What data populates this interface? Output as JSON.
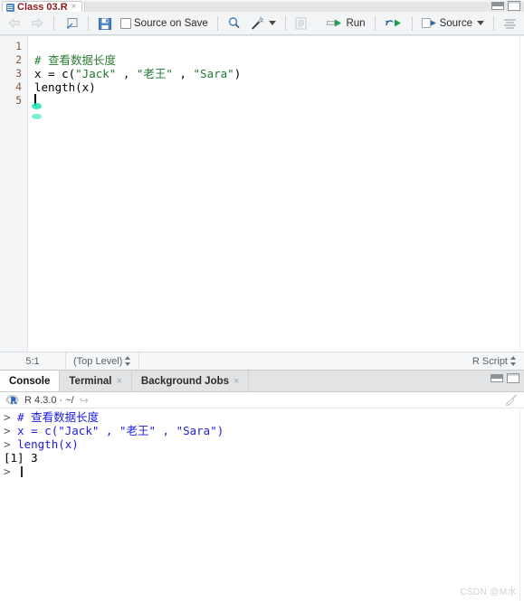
{
  "source_pane": {
    "tab": {
      "icon": "r-document-icon",
      "name": "Class 03.R",
      "close": "×"
    },
    "window_controls": {
      "minimize": "minimize-icon",
      "maximize": "maximize-icon"
    },
    "toolbar": {
      "back": "back-arrow-icon",
      "forward": "forward-arrow-icon",
      "popout": "show-in-new-window-icon",
      "save": "save-icon",
      "source_on_save_checkbox": "checkbox",
      "source_on_save_label": "Source on Save",
      "find": "find-replace-icon",
      "wand": "code-tools-icon",
      "wand_caret": "chevron-down-icon",
      "outline": "document-outline-icon",
      "run_label": "Run",
      "rerun": "rerun-previous-icon",
      "source_label": "Source",
      "source_caret": "chevron-down-icon",
      "show_outline": "show-document-outline-icon"
    },
    "editor": {
      "line_numbers": [
        "1",
        "2",
        "3",
        "4",
        "5"
      ],
      "lines": [
        {
          "num": "1",
          "tokens": []
        },
        {
          "num": "2",
          "tokens": [
            {
              "t": "# 查看数据长度",
              "c": "comment"
            }
          ]
        },
        {
          "num": "3",
          "tokens": [
            {
              "t": "x = c(",
              "c": "plain"
            },
            {
              "t": "\"Jack\"",
              "c": "str"
            },
            {
              "t": " , ",
              "c": "plain"
            },
            {
              "t": "\"老王\"",
              "c": "str"
            },
            {
              "t": " , ",
              "c": "plain"
            },
            {
              "t": "\"Sara\"",
              "c": "str"
            },
            {
              "t": ")",
              "c": "plain"
            }
          ]
        },
        {
          "num": "4",
          "tokens": [
            {
              "t": "length(x)",
              "c": "plain"
            }
          ]
        },
        {
          "num": "5",
          "tokens": []
        }
      ],
      "line1_text": "",
      "line2_text": "# 查看数据长度",
      "line3_a": "x = c(",
      "line3_s1": "\"Jack\"",
      "line3_b": " , ",
      "line3_s2": "\"老王\"",
      "line3_c": " , ",
      "line3_s3": "\"Sara\"",
      "line3_d": ")",
      "line4_text": "length(x)",
      "line5_text": ""
    },
    "status_bar": {
      "cursor_position": "5:1",
      "scope": "(Top Level)",
      "scope_stepper": "up-down-arrows-icon",
      "file_type": "R Script",
      "file_type_stepper": "up-down-arrows-icon"
    }
  },
  "console_pane": {
    "tabs": [
      {
        "label": "Console",
        "active": true,
        "closable": false
      },
      {
        "label": "Terminal",
        "active": false,
        "closable": true,
        "close": "×"
      },
      {
        "label": "Background Jobs",
        "active": false,
        "closable": true,
        "close": "×"
      }
    ],
    "window_controls": {
      "minimize": "minimize-icon",
      "maximize": "maximize-icon"
    },
    "header": {
      "logo": "r-logo-icon",
      "version": "R 4.3.0 · ~/",
      "popout_arrow": "↪",
      "clear_console": "broom-icon"
    },
    "output_lines": [
      {
        "prompt": "> ",
        "text": "# 查看数据长度",
        "kind": "input"
      },
      {
        "prompt": "> ",
        "text": "x = c(\"Jack\" , \"老王\" , \"Sara\")",
        "kind": "input"
      },
      {
        "prompt": "> ",
        "text": "length(x)",
        "kind": "input"
      },
      {
        "prompt": "",
        "text": "[1] 3",
        "kind": "output"
      },
      {
        "prompt": "> ",
        "text": "",
        "kind": "prompt"
      }
    ]
  },
  "watermark": "CSDN @M水",
  "colors": {
    "string_green": "#1f7a33",
    "comment_green": "#2e7d32",
    "console_input_blue": "#1c1ce0",
    "gutter_number": "#8a5a3b",
    "tab_title_red": "#8b1a1a",
    "run_green": "#22a14a",
    "panel_bg": "#f2f4f5",
    "marker_green": "#19e6b0"
  }
}
